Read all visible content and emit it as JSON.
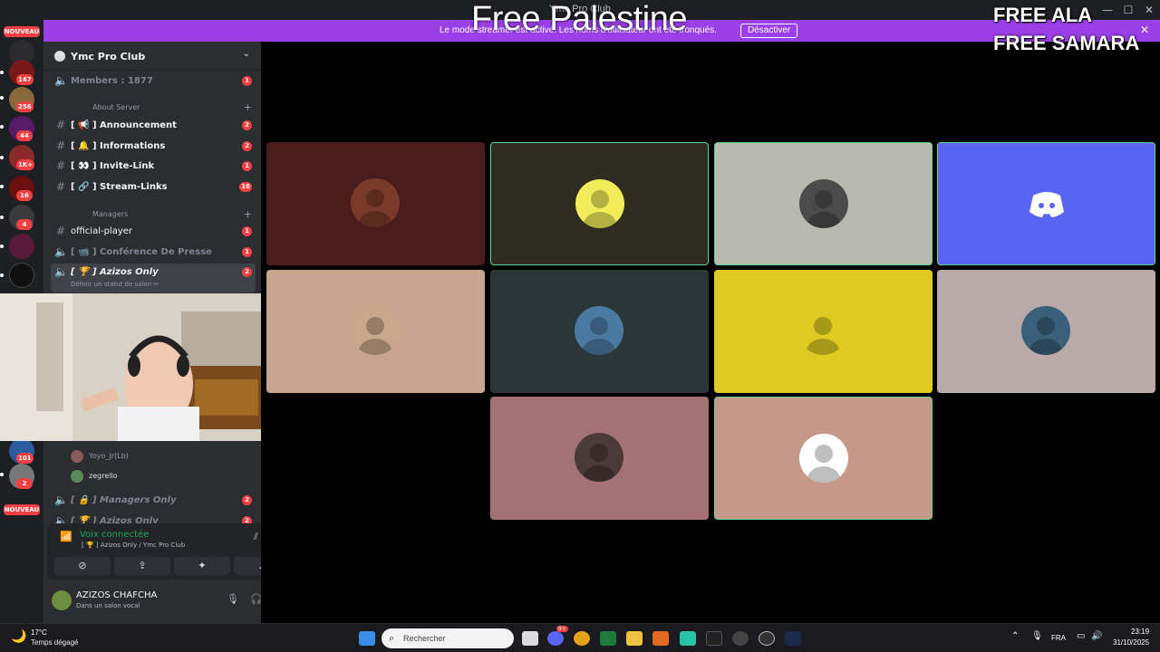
{
  "window": {
    "title": "Ymc Pro Club"
  },
  "overlay": {
    "center_text": "Free Palestine",
    "right_lines": [
      "FREE ALA",
      "FREE SAMARA"
    ]
  },
  "banner": {
    "message": "Le mode streamer est activé. Les noms d'utilisateur ont été tronqués.",
    "button": "Désactiver"
  },
  "rail": {
    "new_label": "NOUVEAU",
    "guild_badges": [
      "147",
      "256",
      "44",
      "1K+",
      "16",
      "4",
      "101",
      "2"
    ]
  },
  "server": {
    "name": "Ymc Pro Club",
    "members_label": "Members : 1877",
    "members_count": "1",
    "categories": [
      "About Server",
      "Managers"
    ],
    "channels": [
      {
        "label": "[ 📢 ] Announcement",
        "count": "2"
      },
      {
        "label": "[ 🔔 ] Informations",
        "count": "2"
      },
      {
        "label": "[ 👀 ] Invite-Link",
        "count": "1"
      },
      {
        "label": "[ 🔗 ] Stream-Links",
        "count": "16"
      },
      {
        "label": "official-player",
        "count": "1"
      },
      {
        "label": "[ 📹 ] Conférence De Presse",
        "count": "1"
      },
      {
        "label": "[ 🏆 ] Azizos Only",
        "count": "2",
        "status": "Définir un statut de salon ✏"
      },
      {
        "label": "[ 🔒 ] Managers Only",
        "count": "2"
      },
      {
        "label": "[ 🏆 ] Azizos Only",
        "count": "2"
      }
    ],
    "voice_users": [
      "Yoyo_Jr(Lb)",
      "zegrello"
    ]
  },
  "voice_panel": {
    "status": "Voix connectée",
    "channel": "[ 🏆 ] Azizos Only / Ymc Pro Club"
  },
  "user": {
    "name": "AZIZOS CHAFCHA",
    "status": "Dans un salon vocal"
  },
  "tiles": [
    {
      "bg": "#4a1c1c",
      "avatar": "#7a3a2a",
      "speaking": false
    },
    {
      "bg": "#2e2c1f",
      "avatar": "#f1ec5a",
      "speaking": true
    },
    {
      "bg": "#b8bab0",
      "avatar": "#4b4b4b",
      "speaking": true
    },
    {
      "bg": "#5865f2",
      "avatar": "discord-logo",
      "speaking": true
    },
    {
      "bg": "#c7a58f",
      "avatar": "#c9a78a",
      "speaking": false
    },
    {
      "bg": "#2b3638",
      "avatar": "#4a7aa0",
      "speaking": false
    },
    {
      "bg": "#decb22",
      "avatar": "#decb22",
      "speaking": false
    },
    {
      "bg": "#b9a9a8",
      "avatar": "#3a5f78",
      "speaking": false
    },
    {
      "bg": "#a47275",
      "avatar": "#4a3a38",
      "speaking": false
    },
    {
      "bg": "#c6988a",
      "avatar": "#ffffff",
      "speaking": true
    }
  ],
  "taskbar": {
    "weather_temp": "17°C",
    "weather_desc": "Temps dégagé",
    "search_placeholder": "Rechercher",
    "lang": "FRA",
    "time": "23:19",
    "date": "31/10/2025",
    "discord_badge": "9+"
  }
}
